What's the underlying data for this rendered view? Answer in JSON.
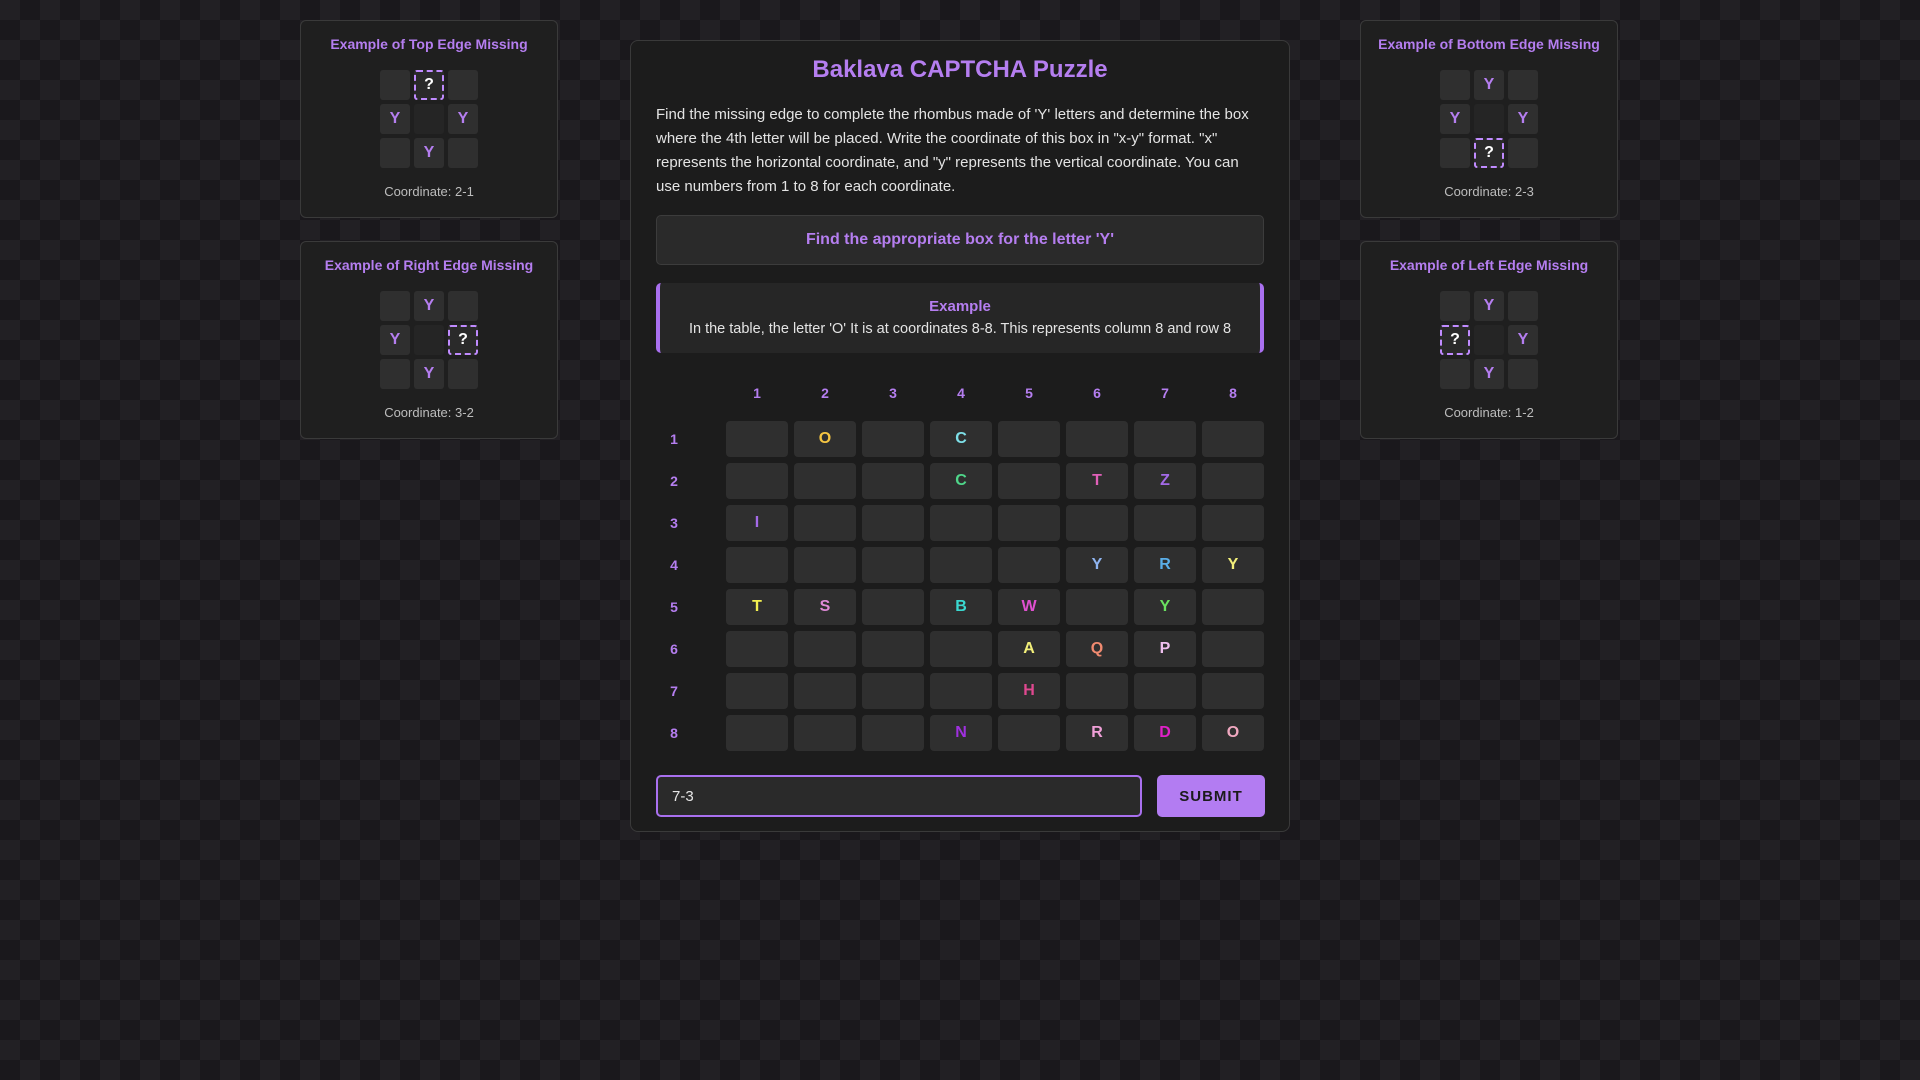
{
  "examples": [
    {
      "title": "Example of Top Edge Missing",
      "cells": [
        "",
        "?",
        "",
        "Y",
        "",
        "Y",
        "",
        "Y",
        ""
      ],
      "coordinate": "Coordinate: 2-1"
    },
    {
      "title": "Example of Right Edge Missing",
      "cells": [
        "",
        "Y",
        "",
        "Y",
        "",
        "?",
        "",
        "Y",
        ""
      ],
      "coordinate": "Coordinate: 3-2"
    },
    {
      "title": "Example of Bottom Edge Missing",
      "cells": [
        "",
        "Y",
        "",
        "Y",
        "",
        "Y",
        "",
        "?",
        ""
      ],
      "coordinate": "Coordinate: 2-3"
    },
    {
      "title": "Example of Left Edge Missing",
      "cells": [
        "",
        "Y",
        "",
        "?",
        "",
        "Y",
        "",
        "Y",
        ""
      ],
      "coordinate": "Coordinate: 1-2"
    }
  ],
  "main": {
    "title": "Baklava CAPTCHA Puzzle",
    "description": "Find the missing edge to complete the rhombus made of 'Y' letters and determine the box where the 4th letter will be placed. Write the coordinate of this box in \"x-y\" format. \"x\" represents the horizontal coordinate, and \"y\" represents the vertical coordinate. You can use numbers from 1 to 8 for each coordinate.",
    "find_text": "Find the appropriate box for the letter 'Y'",
    "example_title": "Example",
    "example_text": "In the table, the letter 'O' It is at coordinates 8-8. This represents column 8 and row 8"
  },
  "grid": {
    "col_labels": [
      "1",
      "2",
      "3",
      "4",
      "5",
      "6",
      "7",
      "8"
    ],
    "row_labels": [
      "1",
      "2",
      "3",
      "4",
      "5",
      "6",
      "7",
      "8"
    ],
    "rows": [
      [
        {
          "t": ""
        },
        {
          "t": "O",
          "c": "#f5c542"
        },
        {
          "t": ""
        },
        {
          "t": "C",
          "c": "#7ee0e8"
        },
        {
          "t": ""
        },
        {
          "t": ""
        },
        {
          "t": ""
        },
        {
          "t": ""
        }
      ],
      [
        {
          "t": ""
        },
        {
          "t": ""
        },
        {
          "t": ""
        },
        {
          "t": "C",
          "c": "#4fd68a"
        },
        {
          "t": ""
        },
        {
          "t": "T",
          "c": "#e060b8"
        },
        {
          "t": "Z",
          "c": "#a46ae8"
        },
        {
          "t": ""
        }
      ],
      [
        {
          "t": "I",
          "c": "#a46ae8"
        },
        {
          "t": ""
        },
        {
          "t": ""
        },
        {
          "t": ""
        },
        {
          "t": ""
        },
        {
          "t": ""
        },
        {
          "t": ""
        },
        {
          "t": ""
        }
      ],
      [
        {
          "t": ""
        },
        {
          "t": ""
        },
        {
          "t": ""
        },
        {
          "t": ""
        },
        {
          "t": ""
        },
        {
          "t": "Y",
          "c": "#8fb4f0"
        },
        {
          "t": "R",
          "c": "#5aaee8"
        },
        {
          "t": "Y",
          "c": "#f2ef7a"
        }
      ],
      [
        {
          "t": "T",
          "c": "#f2ef50"
        },
        {
          "t": "S",
          "c": "#e08ad8"
        },
        {
          "t": ""
        },
        {
          "t": "B",
          "c": "#3ad8d0"
        },
        {
          "t": "W",
          "c": "#e050d0"
        },
        {
          "t": ""
        },
        {
          "t": "Y",
          "c": "#6ae060"
        },
        {
          "t": ""
        }
      ],
      [
        {
          "t": ""
        },
        {
          "t": ""
        },
        {
          "t": ""
        },
        {
          "t": ""
        },
        {
          "t": "A",
          "c": "#f2ef7a"
        },
        {
          "t": "Q",
          "c": "#f08a70"
        },
        {
          "t": "P",
          "c": "#f0c0f0"
        },
        {
          "t": ""
        }
      ],
      [
        {
          "t": ""
        },
        {
          "t": ""
        },
        {
          "t": ""
        },
        {
          "t": ""
        },
        {
          "t": "H",
          "c": "#e04890"
        },
        {
          "t": ""
        },
        {
          "t": ""
        },
        {
          "t": ""
        }
      ],
      [
        {
          "t": ""
        },
        {
          "t": ""
        },
        {
          "t": ""
        },
        {
          "t": "N",
          "c": "#a030e0"
        },
        {
          "t": ""
        },
        {
          "t": "R",
          "c": "#f0a0d8"
        },
        {
          "t": "D",
          "c": "#e020c8"
        },
        {
          "t": "O",
          "c": "#f0a8c0"
        }
      ]
    ]
  },
  "answer": {
    "value": "7-3",
    "placeholder": ""
  },
  "submit_label": "SUBMIT"
}
